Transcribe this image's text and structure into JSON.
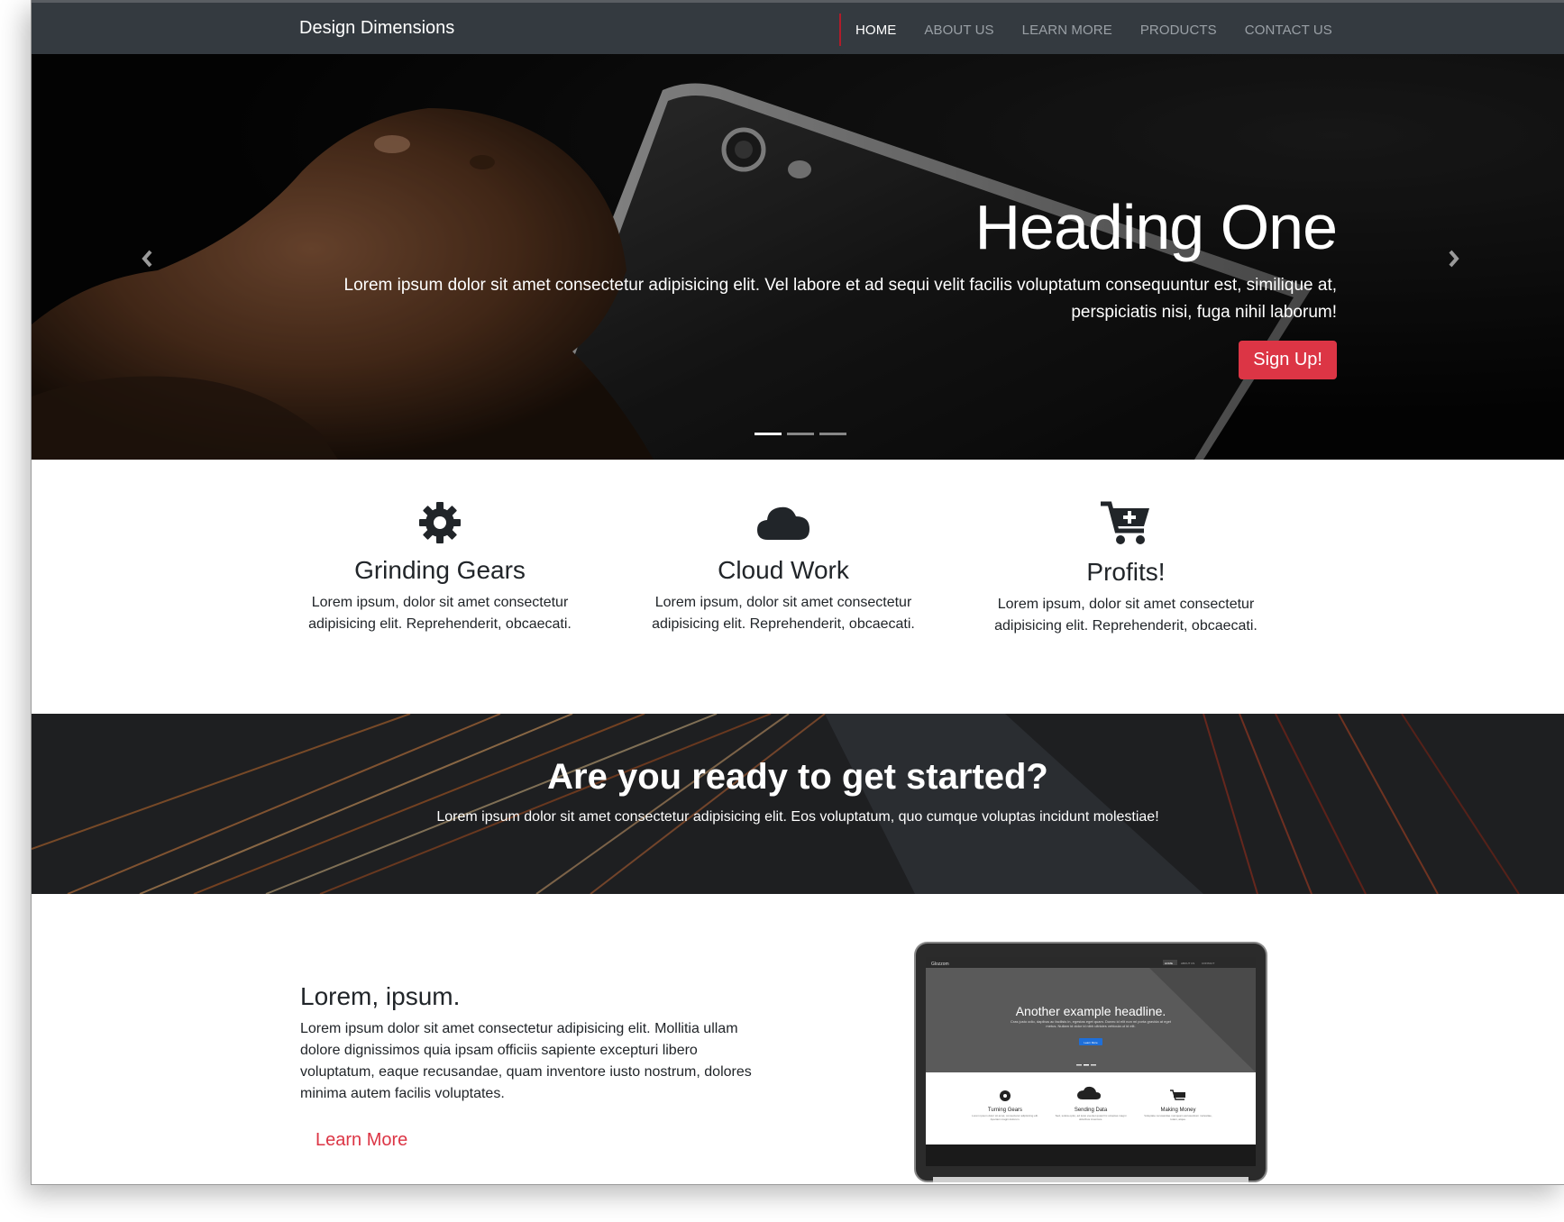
{
  "navbar": {
    "brand": "Design Dimensions",
    "links": [
      "HOME",
      "ABOUT US",
      "LEARN MORE",
      "PRODUCTS",
      "CONTACT US"
    ],
    "active": "HOME"
  },
  "hero": {
    "heading": "Heading One",
    "text": "Lorem ipsum dolor sit amet consectetur adipisicing elit. Vel labore et ad sequi velit facilis voluptatum consequuntur est, similique at, perspiciatis nisi, fuga nihil laborum!",
    "button": "Sign Up!",
    "slides": 3,
    "active_slide": 1,
    "prev_icon": "chevron-left-icon",
    "next_icon": "chevron-right-icon"
  },
  "features": [
    {
      "icon": "gear-icon",
      "title": "Grinding Gears",
      "text": "Lorem ipsum, dolor sit amet consectetur adipisicing elit. Reprehenderit, obcaecati."
    },
    {
      "icon": "cloud-icon",
      "title": "Cloud Work",
      "text": "Lorem ipsum, dolor sit amet consectetur adipisicing elit. Reprehenderit, obcaecati."
    },
    {
      "icon": "cart-plus-icon",
      "title": "Profits!",
      "text": "Lorem ipsum, dolor sit amet consectetur adipisicing elit. Reprehenderit, obcaecati."
    }
  ],
  "cta": {
    "title": "Are you ready to get started?",
    "text": "Lorem ipsum dolor sit amet consectetur adipisicing elit. Eos voluptatum, quo cumque voluptas incidunt molestiae!"
  },
  "info": {
    "title": "Lorem, ipsum.",
    "text": "Lorem ipsum dolor sit amet consectetur adipisicing elit. Mollitia ullam dolore dignissimos quia ipsam officiis sapiente excepturi libero voluptatum, eaque recusandae, quam inventore iusto nostrum, dolores minima autem facilis voluptates.",
    "link": "Learn More"
  },
  "laptop_screen": {
    "brand": "Glozzom",
    "nav": [
      "HOME",
      "ABOUT US",
      "CONTACT"
    ],
    "headline": "Another example headline.",
    "text": "Cras justo odio, dapibus ac facilisis in, egestas eget quam. Donec id elit non mi porta gravida at eget metus. Nullam id dolor id nibh ultricies vehicula ut id elit.",
    "button": "Learn More",
    "features": [
      {
        "title": "Turning Gears",
        "text": "Lorem ipsum dolor sit amet, consectetur adipisicing elit. Aperiam magni dolorum."
      },
      {
        "title": "Sending Data",
        "text": "Sed, soluta optio, ad iusto eveniet quasi hic voluptas magni doloribus inventore."
      },
      {
        "title": "Making Money",
        "text": "Voluptate recusandae numquam accusantium molestiae, totam, atque."
      }
    ]
  },
  "colors": {
    "navbar": "#343a40",
    "accent": "#dc3545",
    "text": "#212529"
  }
}
